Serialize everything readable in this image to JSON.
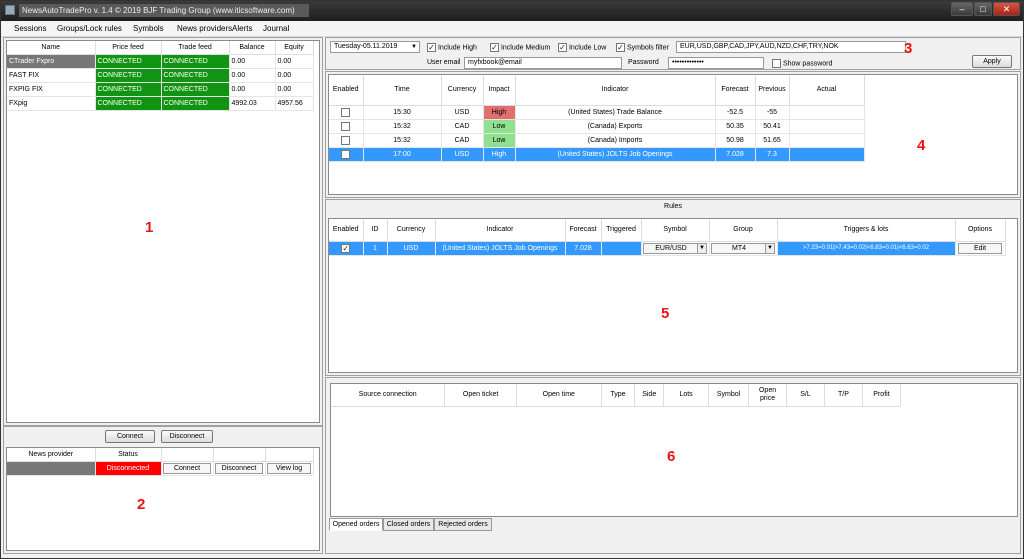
{
  "window": {
    "title": "NewsAutoTradePro v. 1.4 © 2019 BJF Trading Group (www.iticsoftware.com)",
    "minimize": "–",
    "maximize": "□",
    "close": "✕"
  },
  "menu": [
    "Sessions",
    "Groups/Lock rules",
    "Symbols",
    "News providers",
    "Alerts",
    "Journal"
  ],
  "connections": {
    "columns": [
      "Name",
      "Price feed",
      "Trade feed",
      "Balance",
      "Equity"
    ],
    "rows": [
      {
        "name": "CTrader Fxpro",
        "price": "CONNECTED",
        "trade": "CONNECTED",
        "balance": "0.00",
        "equity": "0.00"
      },
      {
        "name": "FAST FIX",
        "price": "CONNECTED",
        "trade": "CONNECTED",
        "balance": "0.00",
        "equity": "0.00"
      },
      {
        "name": "FXPIG FIX",
        "price": "CONNECTED",
        "trade": "CONNECTED",
        "balance": "0.00",
        "equity": "0.00"
      },
      {
        "name": "FXpig",
        "price": "CONNECTED",
        "trade": "CONNECTED",
        "balance": "4992.03",
        "equity": "4957.56"
      }
    ],
    "connect_label": "Connect",
    "disconnect_label": "Disconnect"
  },
  "news_providers": {
    "columns": [
      "News provider",
      "Status"
    ],
    "row": {
      "provider": "",
      "status": "Disconnected"
    },
    "connect_label": "Connect",
    "disconnect_label": "Disconnect",
    "viewlog_label": "View log"
  },
  "filters": {
    "date": "Tuesday-05.11.2019",
    "include_high": "Include High",
    "include_medium": "Include Medium",
    "include_low": "Include Low",
    "symbols_filter": "Symbols filter",
    "symbols_value": "EUR,USD,GBP,CAD,JPY,AUD,NZD,CHF,TRY,NOK",
    "user_email_label": "User email",
    "user_email_value": "myfxbook@email",
    "password_label": "Password",
    "password_value": "•••••••••••••",
    "show_password": "Show password",
    "apply_label": "Apply"
  },
  "calendar": {
    "columns": [
      "Enabled",
      "Time",
      "Currency",
      "Impact",
      "Indicator",
      "Forecast",
      "Previous",
      "Actual"
    ],
    "rows": [
      {
        "time": "15:30",
        "currency": "USD",
        "impact": "High",
        "indicator": "(United States) Trade Balance",
        "forecast": "-52.5",
        "previous": "-55",
        "actual": ""
      },
      {
        "time": "15:32",
        "currency": "CAD",
        "impact": "Low",
        "indicator": "(Canada) Exports",
        "forecast": "50.35",
        "previous": "50.41",
        "actual": ""
      },
      {
        "time": "15:32",
        "currency": "CAD",
        "impact": "Low",
        "indicator": "(Canada) Imports",
        "forecast": "50.98",
        "previous": "51.65",
        "actual": ""
      },
      {
        "time": "17:00",
        "currency": "USD",
        "impact": "High",
        "indicator": "(United States) JOLTS Job Openings",
        "forecast": "7.028",
        "previous": "7.3",
        "actual": ""
      }
    ]
  },
  "rules": {
    "title": "Rules",
    "columns": [
      "Enabled",
      "ID",
      "Currency",
      "Indicator",
      "Forecast",
      "Triggered",
      "Symbol",
      "Group",
      "Triggers & lots",
      "Options"
    ],
    "row": {
      "id": "1",
      "currency": "USD",
      "indicator": "(United States) JOLTS Job Openings",
      "forecast": "7.028",
      "triggered": "",
      "symbol": "EUR/USD",
      "group": "MT4",
      "triggers": ">7.23=0.01|>7.43=0.02|<6.83=0.01|<6.63=0.02",
      "edit_label": "Edit"
    }
  },
  "orders": {
    "columns": [
      "Source connection",
      "Open ticket",
      "Open time",
      "Type",
      "Side",
      "Lots",
      "Symbol",
      "Open price",
      "S/L",
      "T/P",
      "Profit"
    ],
    "tabs": [
      "Opened orders",
      "Closed orders",
      "Rejected orders"
    ]
  },
  "annotations": [
    "1",
    "2",
    "3",
    "4",
    "5",
    "6"
  ],
  "colors": {
    "connected": "#119411",
    "disconnected": "#ff0000",
    "high": "#e07070",
    "low": "#8fe08f",
    "selected": "#3399ff",
    "annotation": "#e11111"
  }
}
